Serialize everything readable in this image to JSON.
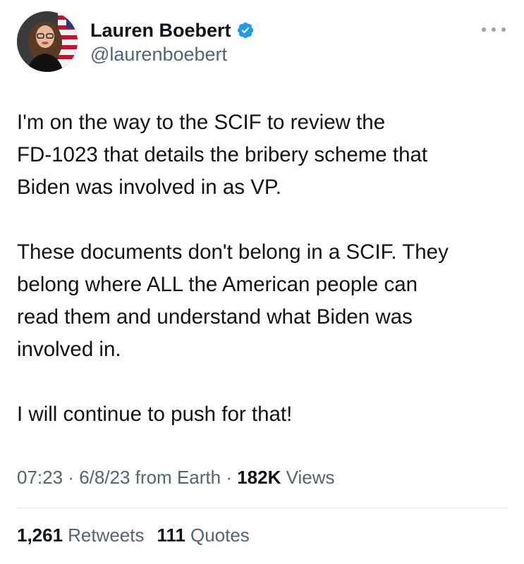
{
  "user": {
    "display_name": "Lauren Boebert",
    "handle": "@laurenboebert",
    "verified_badge_color": "#1d9bf0"
  },
  "icons": {
    "verified": "verified-badge-icon",
    "more": "more-options-icon"
  },
  "tweet": {
    "paragraphs": [
      [
        "I'm on the way to the SCIF to review the",
        "FD-1023 that details the bribery scheme that",
        "Biden was involved in as VP."
      ],
      [
        "These documents don't belong in a SCIF. They",
        "belong where ALL the American people can",
        "read them and understand what Biden was",
        "involved in."
      ],
      [
        "I will continue to push for that!"
      ]
    ]
  },
  "meta": {
    "time": "07:23",
    "separator": " · ",
    "date": "6/8/23",
    "source": "from Earth",
    "views_count": "182K",
    "views_label": "Views"
  },
  "stats": {
    "retweets_count": "1,261",
    "retweets_label": "Retweets",
    "quotes_count": "111",
    "quotes_label": "Quotes"
  }
}
